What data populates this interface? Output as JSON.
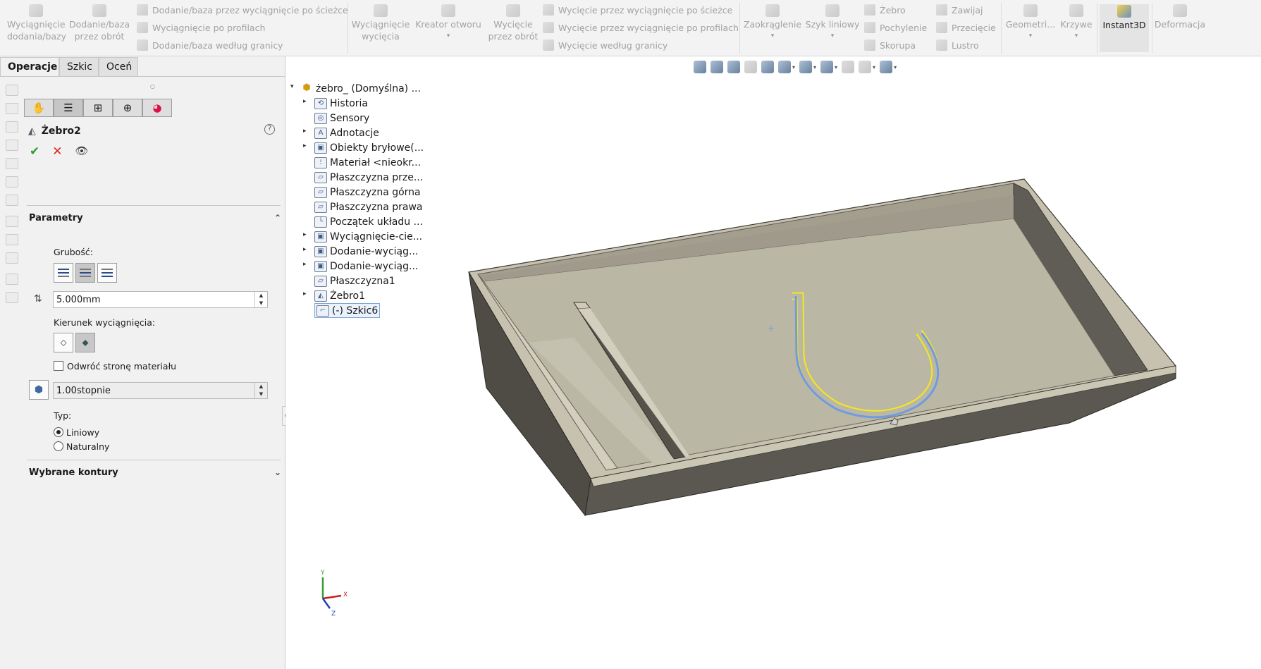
{
  "ribbon": {
    "extruded_boss": "Wyciągnięcie\ndodania/bazy",
    "revolved_boss": "Dodanie/baza\nprzez obrót",
    "swept_boss": "Dodanie/baza przez wyciągnięcie po ścieżce",
    "lofted_boss": "Wyciągnięcie po profilach",
    "boundary_boss": "Dodanie/baza według granicy",
    "extruded_cut": "Wyciągnięcie\nwycięcia",
    "hole_wizard": "Kreator otworu",
    "revolved_cut": "Wycięcie\nprzez obrót",
    "swept_cut": "Wycięcie przez wyciągnięcie po ścieżce",
    "lofted_cut": "Wycięcie przez wyciągnięcie po profilach",
    "boundary_cut": "Wycięcie według granicy",
    "fillet": "Zaokrąglenie",
    "linear_pattern": "Szyk liniowy",
    "rib": "Żebro",
    "wrap": "Zawijaj",
    "draft": "Pochylenie",
    "intersect": "Przecięcie",
    "shell": "Skorupa",
    "mirror": "Lustro",
    "reference_geometry": "Geometri...",
    "curves": "Krzywe",
    "instant3d": "Instant3D",
    "deform": "Deformacja"
  },
  "tabs": [
    "Operacje",
    "Szkic",
    "Oceń"
  ],
  "pm": {
    "title": "Żebro2",
    "help": "?",
    "params_section": "Parametry",
    "thickness_label": "Grubość:",
    "thickness_value": "5.000mm",
    "extrusion_dir_label": "Kierunek wyciągnięcia:",
    "flip_label": "Odwróć stronę materiału",
    "draft_value": "1.00stopnie",
    "type_label": "Typ:",
    "type_linear": "Liniowy",
    "type_natural": "Naturalny",
    "selected_contours": "Wybrane kontury"
  },
  "tree": {
    "root": "żebro_ (Domyślna) ...",
    "items": [
      {
        "label": "Historia",
        "expand": true
      },
      {
        "label": "Sensory",
        "expand": false
      },
      {
        "label": "Adnotacje",
        "expand": true
      },
      {
        "label": "Obiekty bryłowe(...",
        "expand": true
      },
      {
        "label": "Materiał <nieokr...",
        "expand": false
      },
      {
        "label": "Płaszczyzna prze...",
        "expand": false
      },
      {
        "label": "Płaszczyzna górna",
        "expand": false
      },
      {
        "label": "Płaszczyzna prawa",
        "expand": false
      },
      {
        "label": "Początek układu ...",
        "expand": false
      },
      {
        "label": "Wyciągnięcie-cie...",
        "expand": true
      },
      {
        "label": "Dodanie-wyciąg...",
        "expand": true
      },
      {
        "label": "Dodanie-wyciąg...",
        "expand": true
      },
      {
        "label": "Płaszczyzna1",
        "expand": false
      },
      {
        "label": "Żebro1",
        "expand": true
      },
      {
        "label": "(-) Szkic6",
        "expand": false
      }
    ]
  },
  "triad": {
    "x": "X",
    "y": "Y",
    "z": "Z"
  },
  "colors": {
    "accent": "#2e9b2e",
    "cancel": "#d22020",
    "sketch_highlight": "#f5e91a",
    "sketch_line": "#6f9be0"
  }
}
